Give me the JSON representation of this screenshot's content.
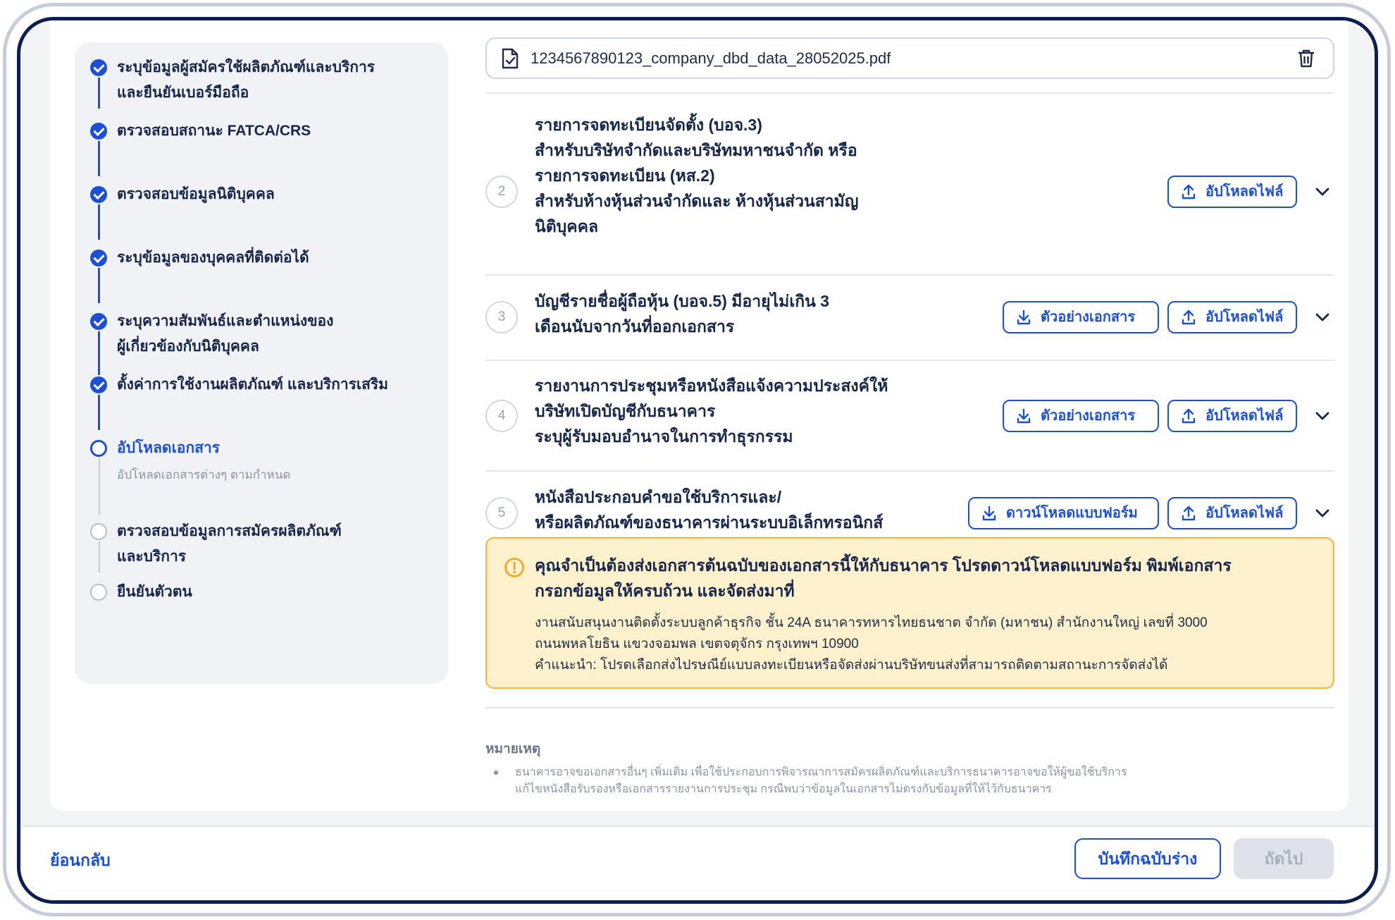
{
  "stepper": {
    "steps": [
      {
        "label_1": "ระบุข้อมูลผู้สมัครใช้ผลิตภัณฑ์และบริการ",
        "label_2": "และยืนยันเบอร์มือถือ",
        "status": "done"
      },
      {
        "label_1": "ตรวจสอบสถานะ FATCA/CRS",
        "status": "done"
      },
      {
        "label_1": "ตรวจสอบข้อมูลนิติบุคคล",
        "status": "done"
      },
      {
        "label_1": "ระบุข้อมูลของบุคคลที่ติดต่อได้",
        "status": "done"
      },
      {
        "label_1": "ระบุความสัมพันธ์และตำแหน่งของ",
        "label_2": "ผู้เกี่ยวข้องกับนิติบุคคล",
        "status": "done"
      },
      {
        "label_1": "ตั้งค่าการใช้งานผลิตภัณฑ์ และบริการเสริม",
        "status": "done"
      },
      {
        "label_1": "อัปโหลดเอกสาร",
        "sub": "อัปโหลดเอกสารต่างๆ ตามกำหนด",
        "status": "current"
      },
      {
        "label_1": "ตรวจสอบข้อมูลการสมัครผลิตภัณฑ์",
        "label_2": "และบริการ",
        "status": "todo"
      },
      {
        "label_1": "ยืนยันตัวตน",
        "status": "todo"
      }
    ]
  },
  "uploaded_file": {
    "name": "1234567890123_company_dbd_data_28052025.pdf",
    "file_icon": "file-check-icon",
    "delete_icon": "trash-icon"
  },
  "documents": [
    {
      "number": "2",
      "lines": [
        "รายการจดทะเบียนจัดตั้ง (บอจ.3)",
        "สำหรับบริษัทจำกัดและบริษัทมหาชนจำกัด หรือ",
        "รายการจดทะเบียน (หส.2)",
        "สำหรับห้างหุ้นส่วนจำกัดและ ห้างหุ้นส่วนสามัญ",
        "นิติบุคคล"
      ],
      "upload_label": "อัปโหลดไฟล์"
    },
    {
      "number": "3",
      "lines": [
        "บัญชีรายชื่อผู้ถือหุ้น (บอจ.5) มีอายุไม่เกิน 3",
        "เดือนนับจากวันที่ออกเอกสาร"
      ],
      "sample_label": "ตัวอย่างเอกสาร",
      "upload_label": "อัปโหลดไฟล์"
    },
    {
      "number": "4",
      "lines": [
        "รายงานการประชุมหรือหนังสือแจ้งความประสงค์ให้",
        "บริษัทเปิดบัญชีกับธนาคาร",
        "ระบุผู้รับมอบอำนาจในการทำธุรกรรม"
      ],
      "sample_label": "ตัวอย่างเอกสาร",
      "upload_label": "อัปโหลดไฟล์"
    },
    {
      "number": "5",
      "lines": [
        "หนังสือประกอบคำขอใช้บริการและ/",
        "หรือผลิตภัณฑ์ของธนาคารผ่านระบบอิเล็กทรอนิกส์"
      ],
      "form_label": "ดาวน์โหลดแบบฟอร์ม",
      "upload_label": "อัปโหลดไฟล์"
    }
  ],
  "alert": {
    "heading_1": "คุณจำเป็นต้องส่งเอกสารต้นฉบับของเอกสารนี้ให้กับธนาคาร โปรดดาวน์โหลดแบบฟอร์ม พิมพ์เอกสาร",
    "heading_2": "กรอกข้อมูลให้ครบถ้วน และจัดส่งมาที่",
    "line_1": "งานสนับสนุนงานติดตั้งระบบลูกค้าธุรกิจ ชั้น 24A  ธนาคารทหารไทยธนชาต จำกัด (มหาชน) สำนักงานใหญ่ เลขที่ 3000",
    "line_2": "ถนนพหลโยธิน แขวงจอมพล เขตจตุจักร กรุงเทพฯ 10900",
    "line_3": "คำแนะนำ: โปรดเลือกส่งไปรษณีย์แบบลงทะเบียนหรือจัดส่งผ่านบริษัทขนส่งที่สามารถติดตามสถานะการจัดส่งได้",
    "icon": "alert-circle-icon",
    "border_color": "#f4b73a",
    "bg_color": "#fdf0cd"
  },
  "notes": {
    "heading": "หมายเหตุ",
    "line_1": "ธนาคารอาจขอเอกสารอื่นๆ เพิ่มเติม   เพื่อใช้ประกอบการพิจารณาการสมัครผลิตภัณฑ์และบริการธนาคารอาจขอให้ผู้ขอใช้บริการ",
    "line_2": "แก้ไขหนังสือรับรองหรือเอกสารรายงานการประชุม   กรณีพบว่าข้อมูลในเอกสารไม่ตรงกับข้อมูลที่ให้ไว้กับธนาคาร"
  },
  "footer": {
    "back_label": "ย้อนกลับ",
    "draft_label": "บันทึกฉบับร่าง",
    "next_label": "ถัดไป"
  },
  "colors": {
    "primary": "#1a4fd6",
    "navy_text": "#16264a",
    "frame": "#0b1f52"
  }
}
